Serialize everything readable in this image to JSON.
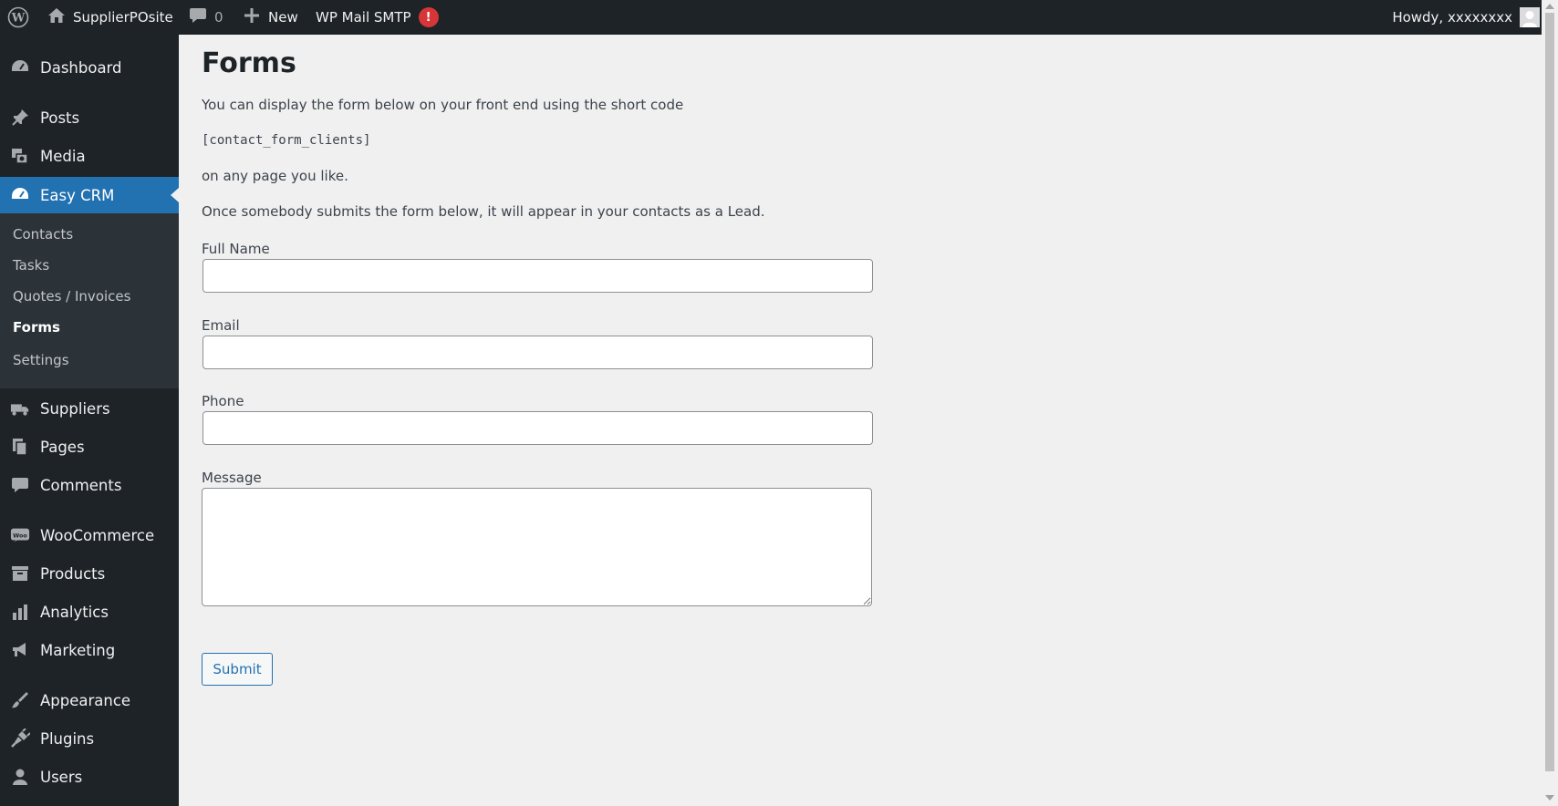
{
  "adminbar": {
    "site_name": "SupplierPOsite",
    "comments_count": "0",
    "new_label": "New",
    "smtp_label": "WP Mail SMTP",
    "smtp_alert": "!",
    "howdy": "Howdy, xxxxxxxx"
  },
  "sidebar": {
    "items": [
      {
        "label": "Dashboard",
        "icon": "dashboard-icon"
      },
      {
        "label": "Posts",
        "icon": "pin-icon"
      },
      {
        "label": "Media",
        "icon": "media-icon"
      },
      {
        "label": "Easy CRM",
        "icon": "gauge-icon",
        "current": true
      },
      {
        "label": "Suppliers",
        "icon": "truck-icon"
      },
      {
        "label": "Pages",
        "icon": "pages-icon"
      },
      {
        "label": "Comments",
        "icon": "comment-icon"
      },
      {
        "label": "WooCommerce",
        "icon": "woo-icon"
      },
      {
        "label": "Products",
        "icon": "archive-icon"
      },
      {
        "label": "Analytics",
        "icon": "bar-chart-icon"
      },
      {
        "label": "Marketing",
        "icon": "megaphone-icon"
      },
      {
        "label": "Appearance",
        "icon": "brush-icon"
      },
      {
        "label": "Plugins",
        "icon": "plug-icon"
      },
      {
        "label": "Users",
        "icon": "user-icon"
      }
    ],
    "submenu": [
      {
        "label": "Contacts"
      },
      {
        "label": "Tasks"
      },
      {
        "label": "Quotes / Invoices"
      },
      {
        "label": "Forms",
        "active": true
      },
      {
        "label": "Settings"
      }
    ]
  },
  "main": {
    "title": "Forms",
    "intro": "You can display the form below on your front end using the short code",
    "shortcode": "[contact_form_clients]",
    "any_page": "on any page you like.",
    "lead_note": "Once somebody submits the form below, it will appear in your contacts as a Lead.",
    "form": {
      "full_name_label": "Full Name",
      "full_name_value": "",
      "email_label": "Email",
      "email_value": "",
      "phone_label": "Phone",
      "phone_value": "",
      "message_label": "Message",
      "message_value": "",
      "submit_label": "Submit"
    }
  },
  "colors": {
    "adminbar_bg": "#1d2327",
    "accent": "#2271b1",
    "content_bg": "#f0f0f1",
    "alert": "#d63638"
  }
}
